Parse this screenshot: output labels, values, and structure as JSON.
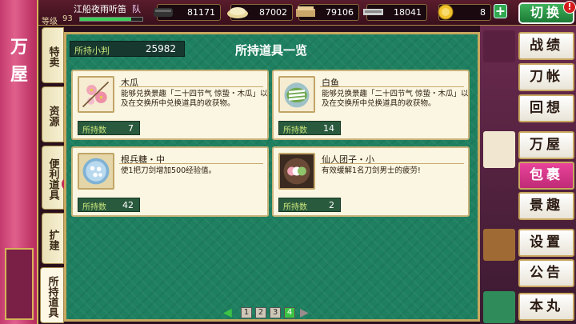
{
  "player": {
    "name": "江船夜雨听笛",
    "team_label": "队",
    "level_label": "等级",
    "level": "93",
    "exp_fraction": 0.82
  },
  "resources": [
    {
      "icon": "charcoal-icon",
      "value": "81171"
    },
    {
      "icon": "whetstone-icon",
      "value": "87002"
    },
    {
      "icon": "jade-steel-icon",
      "value": "79106"
    },
    {
      "icon": "cold-steel-icon",
      "value": "18041"
    },
    {
      "icon": "gold-coin-icon",
      "value": "8"
    }
  ],
  "switch_button": {
    "label": "切换",
    "alert": "!"
  },
  "shop_title": "万屋",
  "left_tabs": [
    {
      "label": "特卖",
      "active": false
    },
    {
      "label": "资源",
      "active": false
    },
    {
      "label": "便利道具",
      "active": false
    },
    {
      "label": "扩建",
      "active": false
    },
    {
      "label": "所持道具",
      "active": true
    }
  ],
  "panel": {
    "money_label": "所持小判",
    "money_value": "25982",
    "title": "所持道具一览",
    "count_label": "所持数"
  },
  "items": [
    {
      "name": "木瓜",
      "description": "能够兑换景趣「二十四节气 惊蛰・木瓜」以及在交换所中兑换道具的收获物。",
      "count": "7",
      "icon": "quince-flower-icon"
    },
    {
      "name": "白鱼",
      "description": "能够兑换景趣「二十四节气 惊蛰・木瓜」以及在交换所中兑换道具的收获物。",
      "count": "14",
      "icon": "white-fish-icon"
    },
    {
      "name": "根兵糖・中",
      "description": "使1把刀剑增加500经验值。",
      "count": "42",
      "icon": "konpeito-icon"
    },
    {
      "name": "仙人团子・小",
      "description": "有效缓解1名刀剑男士的疲劳!",
      "count": "2",
      "icon": "dango-icon"
    }
  ],
  "pagination": {
    "pages": [
      "1",
      "2",
      "3",
      "4"
    ],
    "current": "4"
  },
  "right_menu": [
    {
      "label": "战绩",
      "active": false
    },
    {
      "label": "刀帐",
      "active": false
    },
    {
      "label": "回想",
      "active": false
    },
    {
      "label": "万屋",
      "active": false
    },
    {
      "label": "包裹",
      "active": true
    },
    {
      "label": "景趣",
      "active": false
    },
    {
      "label": "设置",
      "active": false
    },
    {
      "label": "公告",
      "active": false
    },
    {
      "label": "本丸",
      "active": false
    }
  ],
  "colors": {
    "panel_green": "#1e8060",
    "active_pink": "#e9449a",
    "gold_border": "#c9a860"
  }
}
